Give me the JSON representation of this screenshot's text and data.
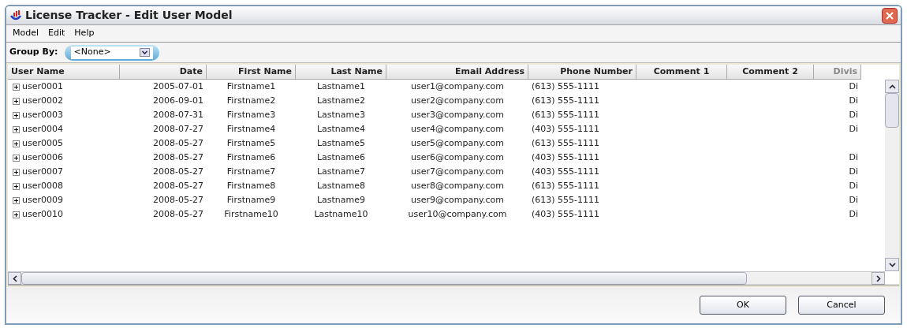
{
  "window": {
    "title": "License Tracker - Edit User Model"
  },
  "menu": [
    "Model",
    "Edit",
    "Help"
  ],
  "group_by": {
    "label": "Group By:",
    "value": "<None>"
  },
  "table": {
    "columns": [
      "User Name",
      "Date",
      "First Name",
      "Last Name",
      "Email Address",
      "Phone Number",
      "Comment 1",
      "Comment 2",
      "Divis"
    ],
    "rows": [
      {
        "expanded": false,
        "cells": [
          "user0001",
          "2005-07-01",
          "Firstname1",
          "Lastname1",
          "user1@company.com",
          "(613) 555-1111",
          "",
          "",
          "Di"
        ]
      },
      {
        "expanded": false,
        "cells": [
          "user0002",
          "2006-09-01",
          "Firstname2",
          "Lastname2",
          "user2@company.com",
          "(613) 555-1111",
          "",
          "",
          "Di"
        ]
      },
      {
        "expanded": false,
        "cells": [
          "user0003",
          "2008-07-31",
          "Firstname3",
          "Lastname3",
          "user3@company.com",
          "(613) 555-1111",
          "",
          "",
          "Di"
        ]
      },
      {
        "expanded": false,
        "cells": [
          "user0004",
          "2008-07-27",
          "Firstname4",
          "Lastname4",
          "user4@company.com",
          "(403) 555-1111",
          "",
          "",
          "Di"
        ]
      },
      {
        "expanded": false,
        "cells": [
          "user0005",
          "2008-05-27",
          "Firstname5",
          "Lastname5",
          "user5@company.com",
          "(613) 555-1111",
          "",
          "",
          ""
        ]
      },
      {
        "expanded": false,
        "cells": [
          "user0006",
          "2008-05-27",
          "Firstname6",
          "Lastname6",
          "user6@company.com",
          "(403) 555-1111",
          "",
          "",
          "Di"
        ]
      },
      {
        "expanded": false,
        "cells": [
          "user0007",
          "2008-05-27",
          "Firstname7",
          "Lastname7",
          "user7@company.com",
          "(403) 555-1111",
          "",
          "",
          "Di"
        ]
      },
      {
        "expanded": false,
        "cells": [
          "user0008",
          "2008-05-27",
          "Firstname8",
          "Lastname8",
          "user8@company.com",
          "(613) 555-1111",
          "",
          "",
          "Di"
        ]
      },
      {
        "expanded": false,
        "cells": [
          "user0009",
          "2008-05-27",
          "Firstname9",
          "Lastname9",
          "user9@company.com",
          "(613) 555-1111",
          "",
          "",
          "Di"
        ]
      },
      {
        "expanded": false,
        "cells": [
          "user0010",
          "2008-05-27",
          "Firstname10",
          "Lastname10",
          "user10@company.com",
          "(403) 555-1111",
          "",
          "",
          "Di"
        ]
      }
    ]
  },
  "buttons": [
    "OK",
    "Cancel"
  ]
}
